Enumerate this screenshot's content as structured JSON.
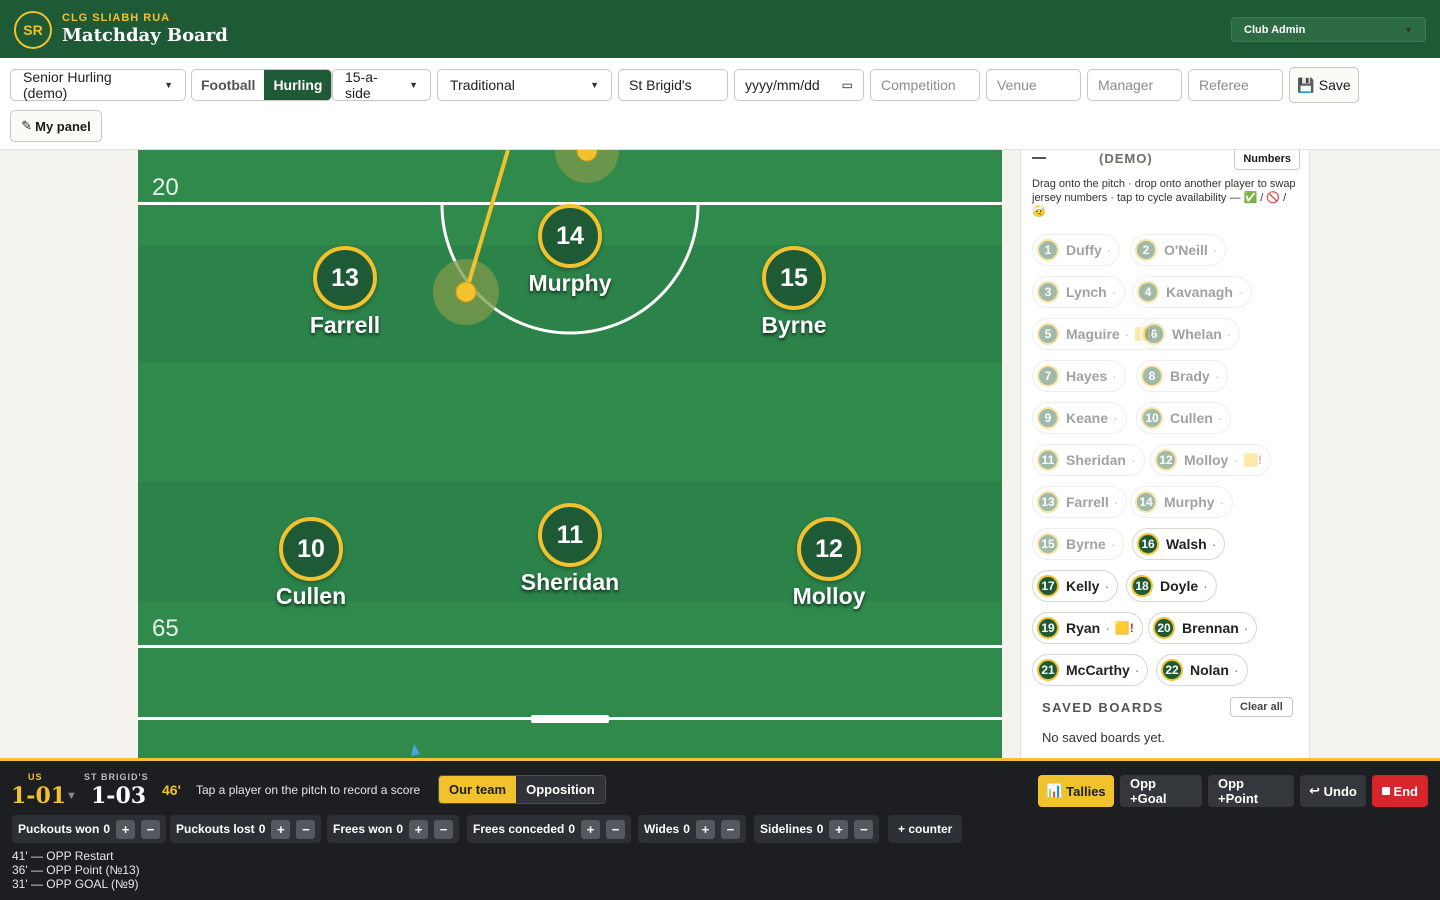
{
  "header": {
    "logo": "SR",
    "club": "CLG SLIABH RUA",
    "title": "Matchday Board",
    "role_select": "Club Admin"
  },
  "toolbar": {
    "team_select": "Senior Hurling (demo)",
    "code_toggle": [
      "Football",
      "Hurling"
    ],
    "code_active": "Hurling",
    "format_select": "15-a-side",
    "formation_select": "Traditional",
    "opponent_value": "St Brigid's",
    "date_placeholder": "yyyy/mm/dd",
    "competition_placeholder": "Competition",
    "venue_placeholder": "Venue",
    "manager_placeholder": "Manager",
    "referee_placeholder": "Referee",
    "save_label": "Save",
    "my_panel_label": "My panel"
  },
  "pitch": {
    "yard_markers": [
      "20",
      "65"
    ],
    "players": [
      {
        "number": "13",
        "name": "Farrell"
      },
      {
        "number": "14",
        "name": "Murphy"
      },
      {
        "number": "15",
        "name": "Byrne"
      },
      {
        "number": "10",
        "name": "Cullen"
      },
      {
        "number": "11",
        "name": "Sheridan"
      },
      {
        "number": "12",
        "name": "Molloy"
      }
    ]
  },
  "panel": {
    "title": "(DEMO)",
    "numbers_button": "Numbers",
    "help": "Drag onto the pitch · drop onto another player to swap jersey numbers · tap to cycle availability — ✅ / 🚫 / 🤕",
    "roster": [
      {
        "number": "1",
        "name": "Duffy",
        "sep": "·",
        "status": ""
      },
      {
        "number": "2",
        "name": "O'Neill",
        "sep": "·",
        "status": ""
      },
      {
        "number": "3",
        "name": "Lynch",
        "sep": "·",
        "status": ""
      },
      {
        "number": "4",
        "name": "Kavanagh",
        "sep": "·",
        "status": ""
      },
      {
        "number": "5",
        "name": "Maguire",
        "sep": "·",
        "status": "🟨!"
      },
      {
        "number": "6",
        "name": "Whelan",
        "sep": "·",
        "status": ""
      },
      {
        "number": "7",
        "name": "Hayes",
        "sep": "·",
        "status": ""
      },
      {
        "number": "8",
        "name": "Brady",
        "sep": "·",
        "status": ""
      },
      {
        "number": "9",
        "name": "Keane",
        "sep": "·",
        "status": ""
      },
      {
        "number": "10",
        "name": "Cullen",
        "sep": "·",
        "status": ""
      },
      {
        "number": "11",
        "name": "Sheridan",
        "sep": "·",
        "status": ""
      },
      {
        "number": "12",
        "name": "Molloy",
        "sep": "·",
        "status": "🟨!"
      },
      {
        "number": "13",
        "name": "Farrell",
        "sep": "·",
        "status": ""
      },
      {
        "number": "14",
        "name": "Murphy",
        "sep": "·",
        "status": ""
      },
      {
        "number": "15",
        "name": "Byrne",
        "sep": "·",
        "status": ""
      },
      {
        "number": "16",
        "name": "Walsh",
        "sep": "·",
        "status": ""
      },
      {
        "number": "17",
        "name": "Kelly",
        "sep": "·",
        "status": ""
      },
      {
        "number": "18",
        "name": "Doyle",
        "sep": "·",
        "status": ""
      },
      {
        "number": "19",
        "name": "Ryan",
        "sep": "·",
        "status": "🟨!"
      },
      {
        "number": "20",
        "name": "Brennan",
        "sep": "·",
        "status": ""
      },
      {
        "number": "21",
        "name": "McCarthy",
        "sep": "·",
        "status": ""
      },
      {
        "number": "22",
        "name": "Nolan",
        "sep": "·",
        "status": ""
      }
    ],
    "saved_title": "SAVED BOARDS",
    "clear_all": "Clear all",
    "saved_empty": "No saved boards yet."
  },
  "scoreboard": {
    "us_label": "US",
    "us_score": "1-01",
    "opp_label": "ST BRIGID'S",
    "opp_score": "1-03",
    "clock": "46'",
    "hint": "Tap a player on the pitch to record a score",
    "side_toggle": [
      "Our team",
      "Opposition"
    ],
    "side_active": "Our team",
    "tallies": "Tallies",
    "opp_goal": "Opp +Goal",
    "opp_point": "Opp +Point",
    "undo": "Undo",
    "end": "End",
    "counters": [
      {
        "label": "Puckouts won",
        "value": "0"
      },
      {
        "label": "Puckouts lost",
        "value": "0"
      },
      {
        "label": "Frees won",
        "value": "0"
      },
      {
        "label": "Frees conceded",
        "value": "0"
      },
      {
        "label": "Wides",
        "value": "0"
      },
      {
        "label": "Sidelines",
        "value": "0"
      }
    ],
    "add_counter": "+ counter",
    "log": [
      "41' — OPP Restart",
      "36' — OPP Point (№13)",
      "31' — OPP GOAL (№9)"
    ]
  },
  "colors": {
    "brand_green": "#1e5a35",
    "accent_gold": "#f2c12e",
    "pitch_green": "#2f8a4b",
    "danger_red": "#d6262b"
  }
}
